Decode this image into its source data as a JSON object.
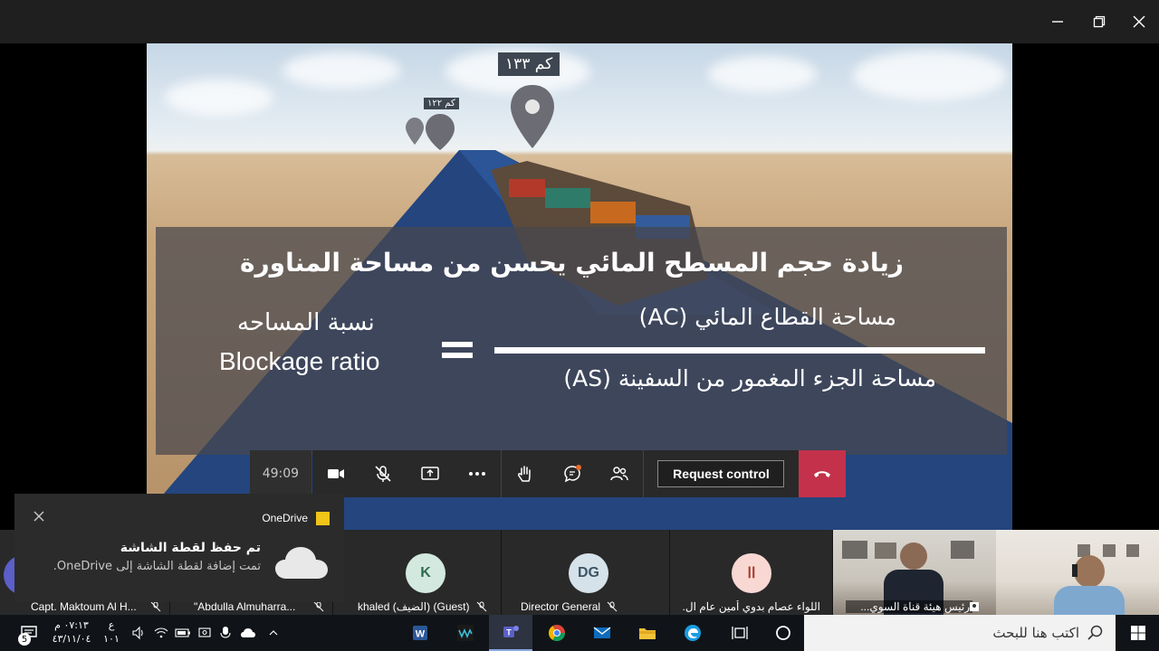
{
  "window": {
    "controls": [
      "minimize",
      "restore",
      "close"
    ]
  },
  "slide": {
    "pin_big": "كم ١٣٣",
    "pin_small": "كم ١٢٢",
    "title": "زيادة حجم المسطح المائي يحسن من مساحة المناورة",
    "numerator": "مساحة القطاع المائي (AC)",
    "denominator": "مساحة الجزء المغمور من السفينة (AS)",
    "ratio_ar": "نسبة المساحه",
    "ratio_en": "Blockage ratio"
  },
  "call_controls": {
    "timer": "49:09",
    "request_control_label": "Request control",
    "buttons": [
      "camera-icon",
      "mic-off-icon",
      "share-icon",
      "more-icon",
      "raise-hand-icon",
      "chat-icon",
      "participants-icon",
      "hangup-icon"
    ]
  },
  "participants": [
    {
      "name": "Capt. Maktoum Al H...",
      "initials": ""
    },
    {
      "name": "\"Abdulla Almuharra...",
      "initials": ""
    },
    {
      "name": "khaled (الضيف) (Guest)",
      "initials": "K"
    },
    {
      "name": "Director General",
      "initials": "DG"
    },
    {
      "name": "اللواء عصام بدوي أمين عام ال...",
      "initials": "اا"
    },
    {
      "name": "رئيس هيئة قناة السوي...",
      "initials": ""
    },
    {
      "name": "",
      "initials": ""
    }
  ],
  "toast": {
    "app_name": "OneDrive",
    "title": "تم حفظ لقطة الشاشة",
    "message": "تمت إضافة لقطة الشاشة إلى OneDrive."
  },
  "taskbar": {
    "search_placeholder": "اكتب هنا للبحث",
    "time": "٠٧:١٣ م",
    "date": "٤٣/١١/٠٤",
    "lang_top": "ع",
    "lang_bottom": "١٠١",
    "notification_count": "5"
  },
  "colors": {
    "hangup": "#c4314b",
    "avatar_k_bg": "#d3e9df",
    "avatar_k_fg": "#2f6b51",
    "avatar_dg_bg": "#d6e2ea",
    "avatar_dg_fg": "#3b5564",
    "avatar_ii_bg": "#f9d8d3",
    "avatar_ii_fg": "#a93a2a"
  }
}
